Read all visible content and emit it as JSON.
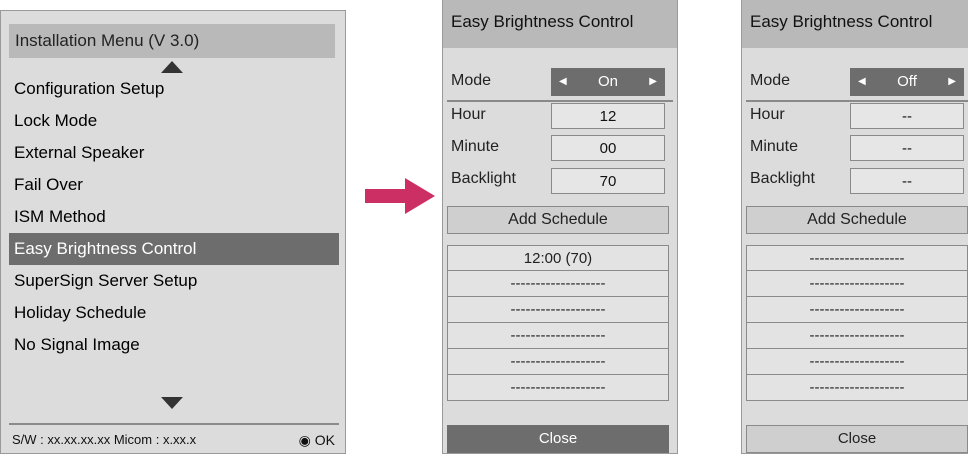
{
  "installation_menu": {
    "title": "Installation Menu (V 3.0)",
    "items": [
      {
        "label": "Configuration Setup",
        "selected": false
      },
      {
        "label": "Lock Mode",
        "selected": false
      },
      {
        "label": "External Speaker",
        "selected": false
      },
      {
        "label": "Fail Over",
        "selected": false
      },
      {
        "label": "ISM Method",
        "selected": false
      },
      {
        "label": "Easy Brightness Control",
        "selected": true
      },
      {
        "label": "SuperSign Server Setup",
        "selected": false
      },
      {
        "label": "Holiday Schedule",
        "selected": false
      },
      {
        "label": "No Signal Image",
        "selected": false
      }
    ],
    "footer_sw": "S/W : xx.xx.xx.xx Micom : x.xx.x",
    "footer_ok": "◉ OK",
    "icons": [
      "scroll-up-icon",
      "scroll-down-icon"
    ]
  },
  "arrow_color": "#cc2f63",
  "ebc_on": {
    "title": "Easy Brightness Control",
    "mode_label": "Mode",
    "mode_value": "On",
    "hour_label": "Hour",
    "hour_value": "12",
    "minute_label": "Minute",
    "minute_value": "00",
    "backlight_label": "Backlight",
    "backlight_value": "70",
    "add_schedule": "Add Schedule",
    "slots": [
      "12:00    (70)",
      "-------------------",
      "-------------------",
      "-------------------",
      "-------------------",
      "-------------------"
    ],
    "close": "Close"
  },
  "ebc_off": {
    "title": "Easy Brightness Control",
    "mode_label": "Mode",
    "mode_value": "Off",
    "hour_label": "Hour",
    "hour_value": "--",
    "minute_label": "Minute",
    "minute_value": "--",
    "backlight_label": "Backlight",
    "backlight_value": "--",
    "add_schedule": "Add Schedule",
    "slots": [
      "-------------------",
      "-------------------",
      "-------------------",
      "-------------------",
      "-------------------",
      "-------------------"
    ],
    "close": "Close"
  },
  "colors": {
    "panel_bg": "#dcdcdc",
    "title_bg": "#b9b9b9",
    "selected_bg": "#6d6d6d",
    "arrow": "#cc2f63"
  }
}
